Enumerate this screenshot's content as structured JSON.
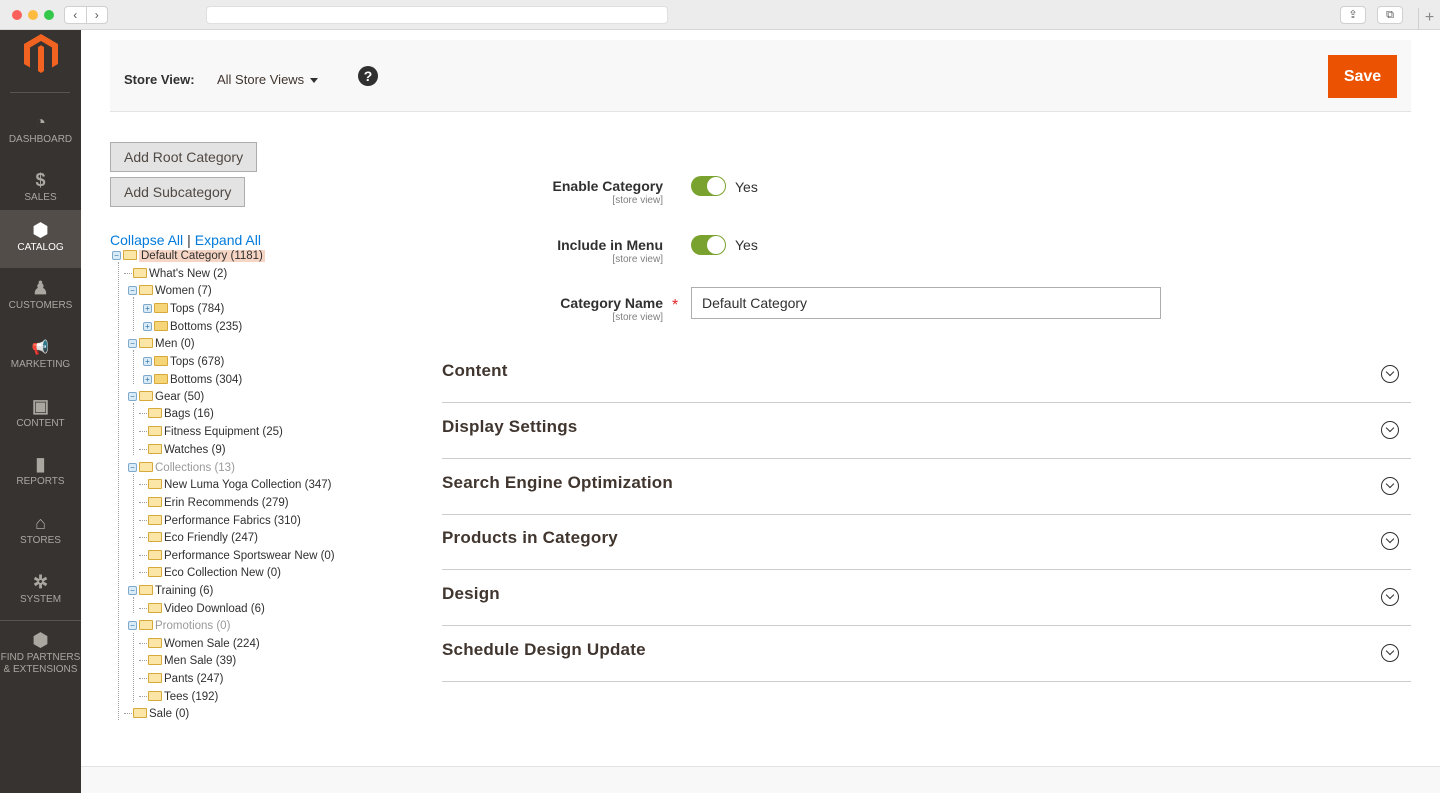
{
  "browser": {
    "back": "‹",
    "forward": "›",
    "share_icon": "⇪",
    "tabs_icon": "⧉",
    "new_tab": "+"
  },
  "sidebar": {
    "items": [
      {
        "label": "DASHBOARD",
        "icon": "◔"
      },
      {
        "label": "SALES",
        "icon": "$"
      },
      {
        "label": "CATALOG",
        "icon": "⬢"
      },
      {
        "label": "CUSTOMERS",
        "icon": "♟"
      },
      {
        "label": "MARKETING",
        "icon": "📢"
      },
      {
        "label": "CONTENT",
        "icon": "▣"
      },
      {
        "label": "REPORTS",
        "icon": "▮"
      },
      {
        "label": "STORES",
        "icon": "⌂"
      },
      {
        "label": "SYSTEM",
        "icon": "✲"
      },
      {
        "label": "FIND PARTNERS",
        "label2": "& EXTENSIONS",
        "icon": "⬢"
      }
    ]
  },
  "toolbar": {
    "store_view_label": "Store View:",
    "store_view_value": "All Store Views",
    "help": "?",
    "save_label": "Save"
  },
  "tree_actions": {
    "add_root": "Add Root Category",
    "add_sub": "Add Subcategory",
    "collapse_all": "Collapse All",
    "separator": "|",
    "expand_all": "Expand All"
  },
  "tree": [
    "Default Category (1181)",
    "What's New (2)",
    "Women (7)",
    "Tops (784)",
    "Bottoms (235)",
    "Men (0)",
    "Tops (678)",
    "Bottoms (304)",
    "Gear (50)",
    "Bags (16)",
    "Fitness Equipment (25)",
    "Watches (9)",
    "Collections (13)",
    "New Luma Yoga Collection (347)",
    "Erin Recommends (279)",
    "Performance Fabrics (310)",
    "Eco Friendly (247)",
    "Performance Sportswear New (0)",
    "Eco Collection New (0)",
    "Training (6)",
    "Video Download (6)",
    "Promotions (0)",
    "Women Sale (224)",
    "Men Sale (39)",
    "Pants (247)",
    "Tees (192)",
    "Sale (0)"
  ],
  "form": {
    "enable_label": "Enable Category",
    "enable_scope": "[store view]",
    "enable_value": "Yes",
    "menu_label": "Include in Menu",
    "menu_scope": "[store view]",
    "menu_value": "Yes",
    "name_label": "Category Name",
    "name_scope": "[store view]",
    "name_required": "*",
    "name_value": "Default Category"
  },
  "sections": [
    "Content",
    "Display Settings",
    "Search Engine Optimization",
    "Products in Category",
    "Design",
    "Schedule Design Update"
  ],
  "colors": {
    "accent": "#eb5202",
    "sidebar": "#373330",
    "toggle_on": "#79a22e",
    "link": "#007bdb"
  }
}
